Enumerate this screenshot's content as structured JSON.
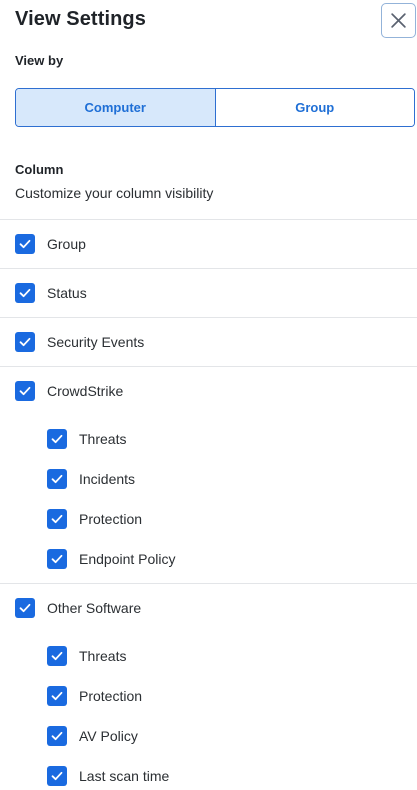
{
  "header": {
    "title": "View Settings"
  },
  "view_by": {
    "label": "View by",
    "options": [
      "Computer",
      "Group"
    ],
    "selected": "Computer"
  },
  "column": {
    "title": "Column",
    "subtitle": "Customize your column visibility"
  },
  "items": {
    "group": {
      "label": "Group",
      "checked": true
    },
    "status": {
      "label": "Status",
      "checked": true
    },
    "security_events": {
      "label": "Security Events",
      "checked": true
    },
    "crowdstrike": {
      "label": "CrowdStrike",
      "checked": true,
      "children": [
        {
          "label": "Threats",
          "checked": true
        },
        {
          "label": "Incidents",
          "checked": true
        },
        {
          "label": "Protection",
          "checked": true
        },
        {
          "label": "Endpoint Policy",
          "checked": true
        }
      ]
    },
    "other_software": {
      "label": "Other Software",
      "checked": true,
      "children": [
        {
          "label": "Threats",
          "checked": true
        },
        {
          "label": "Protection",
          "checked": true
        },
        {
          "label": "AV Policy",
          "checked": true
        },
        {
          "label": "Last scan time",
          "checked": true
        }
      ]
    }
  },
  "colors": {
    "accent": "#1a6ae0",
    "selected_bg": "#d7e8fb",
    "divider": "#e3e5e8"
  }
}
